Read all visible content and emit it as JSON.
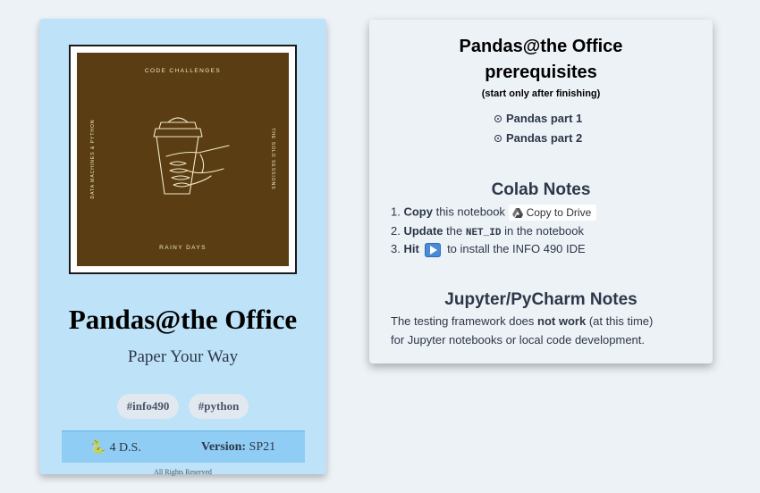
{
  "book": {
    "cover": {
      "top_text": "CODE CHALLENGES",
      "bottom_text": "RAINY DAYS",
      "left_text": "DATA MACHINES & PYTHON",
      "right_text": "THE SOLO SESSIONS"
    },
    "title": "Pandas@the Office",
    "subtitle": "Paper Your Way",
    "tags": [
      "#info490",
      "#python"
    ],
    "ds_label": "4 D.S.",
    "version_label": "Version:",
    "version_value": "SP21",
    "rights": "All Rights Reserved"
  },
  "panel": {
    "title": "Pandas@the Office",
    "subtitle": "prerequisites",
    "note": "(start only after finishing)",
    "prereqs": [
      "Pandas part 1",
      "Pandas part 2"
    ],
    "colab": {
      "heading": "Colab Notes",
      "step1": {
        "num": "1.",
        "bold": "Copy",
        "text": "this notebook",
        "button": "Copy to Drive"
      },
      "step2": {
        "num": "2.",
        "bold": "Update",
        "text_a": "the",
        "code": "NET_ID",
        "text_b": "in the notebook"
      },
      "step3": {
        "num": "3.",
        "bold": "Hit",
        "text": "to install the INFO 490 IDE"
      }
    },
    "jupyter": {
      "heading": "Jupyter/PyCharm Notes",
      "line1_a": "The testing framework does",
      "line1_bold": "not work",
      "line1_b": "(at this time)",
      "line2": "for Jupyter notebooks or local code development."
    }
  },
  "colors": {
    "page_bg": "#edf2f7",
    "card_bg": "#bee3f8",
    "cover_bg": "#5a3d12",
    "info_bar": "#90cdf4",
    "tag_bg": "#e2e8f0",
    "text_dark": "#2d3748"
  },
  "icons": [
    "coffee-cup-hand-icon",
    "snake-icon",
    "google-drive-icon",
    "play-icon",
    "radio-bullet-icon"
  ]
}
